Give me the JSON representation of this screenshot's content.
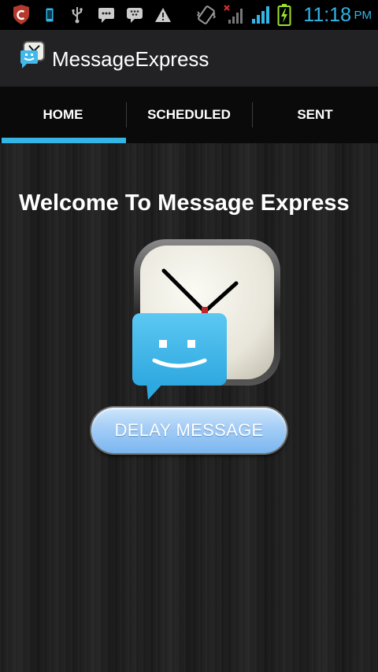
{
  "status_bar": {
    "time": "11:18",
    "ampm": "PM",
    "accent_color": "#33b5e5",
    "icons": [
      "shield-app-icon",
      "phone-icon",
      "usb-icon",
      "sms-icon",
      "bbm-icon",
      "warning-icon",
      "vibrate-icon",
      "no-signal-icon",
      "signal-icon",
      "battery-charging-icon"
    ]
  },
  "action_bar": {
    "title": "MessageExpress",
    "icon": "message-express-app-icon"
  },
  "tabs": [
    {
      "label": "HOME",
      "selected": true
    },
    {
      "label": "SCHEDULED",
      "selected": false
    },
    {
      "label": "SENT",
      "selected": false
    }
  ],
  "main": {
    "welcome": "Welcome To Message Express",
    "delay_button_label": "DELAY MESSAGE",
    "hero_icon": "clock-message-icon"
  },
  "colors": {
    "tab_indicator": "#33b5e5",
    "button_blue": "#7bb6ef"
  }
}
